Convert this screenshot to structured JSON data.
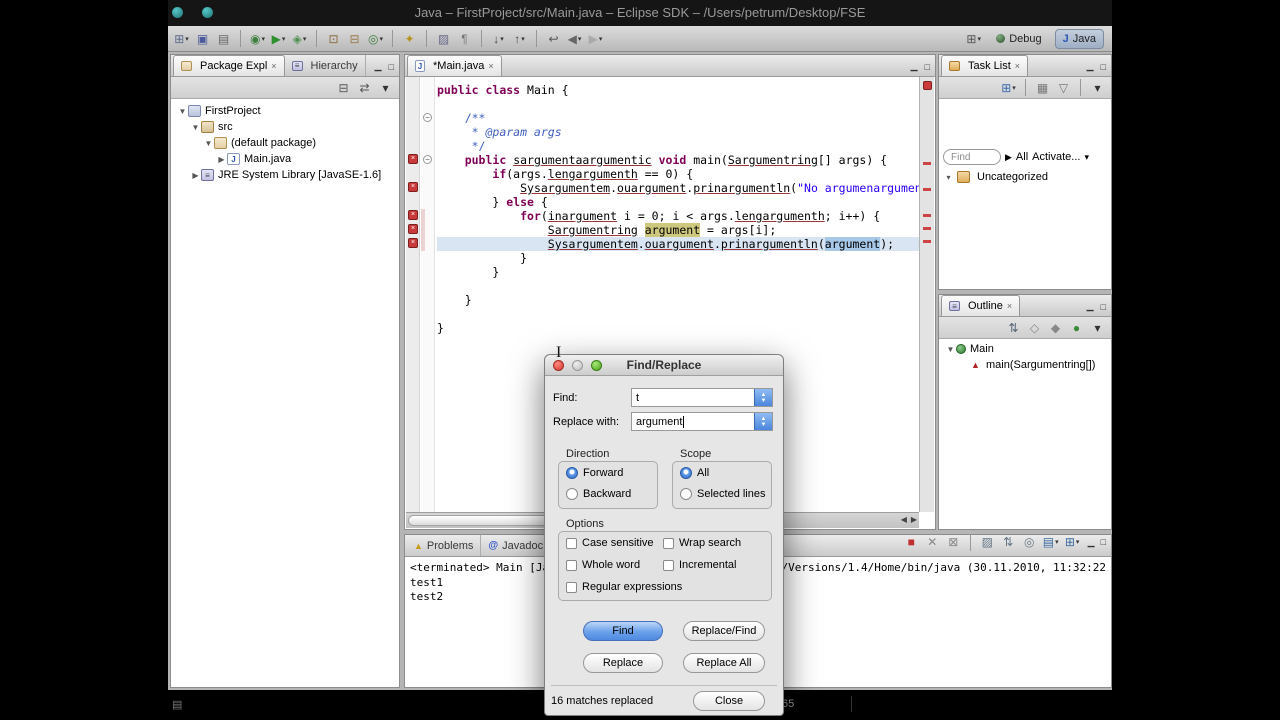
{
  "titlebar": {
    "title": "Java – FirstProject/src/Main.java – Eclipse SDK – /Users/petrum/Desktop/FSE"
  },
  "icons": {
    "minimize": "▁",
    "maximize": "□",
    "close": "×",
    "menu": "▾",
    "collapse_all": "⊟",
    "link_editor": "⇄",
    "chevron_right": "▶",
    "combo_up": "▲",
    "combo_down": "▼",
    "java_file": "J",
    "ibeam": "I",
    "warning": "▲",
    "at": "@",
    "pencil": "▤",
    "scroll_left": "◀",
    "scroll_right": "▶"
  },
  "toolbar": {
    "icons": [
      {
        "name": "new-wizard-icon",
        "glyph": "⊞",
        "color": "#5a6a8a",
        "dropdown": true
      },
      {
        "name": "save-icon",
        "glyph": "▣",
        "color": "#4a5a9a",
        "dropdown": false
      },
      {
        "name": "print-icon",
        "glyph": "▤",
        "color": "#666666",
        "dropdown": false
      },
      {
        "name": "sep"
      },
      {
        "name": "debug-icon",
        "glyph": "◉",
        "color": "#3f7f3f",
        "dropdown": true
      },
      {
        "name": "run-icon",
        "glyph": "▶",
        "color": "#2f8f2f",
        "dropdown": true
      },
      {
        "name": "external-tools-icon",
        "glyph": "◈",
        "color": "#4f8f4f",
        "dropdown": true
      },
      {
        "name": "sep"
      },
      {
        "name": "new-java-project-icon",
        "glyph": "⊡",
        "color": "#8a6a3a",
        "dropdown": false
      },
      {
        "name": "new-package-icon",
        "glyph": "⊟",
        "color": "#9a7a4a",
        "dropdown": false
      },
      {
        "name": "new-class-icon",
        "glyph": "◎",
        "color": "#3f7f3f",
        "dropdown": true
      },
      {
        "name": "sep"
      },
      {
        "name": "search-icon",
        "glyph": "✦",
        "color": "#b8941e",
        "dropdown": false
      },
      {
        "name": "sep"
      },
      {
        "name": "mark-occurrences-icon",
        "glyph": "▨",
        "color": "#6a6a8a",
        "dropdown": false
      },
      {
        "name": "show-whitespace-icon",
        "glyph": "¶",
        "color": "#777777",
        "dropdown": false
      },
      {
        "name": "sep"
      },
      {
        "name": "next-annotation-icon",
        "glyph": "↓",
        "color": "#444444",
        "dropdown": true
      },
      {
        "name": "prev-annotation-icon",
        "glyph": "↑",
        "color": "#444444",
        "dropdown": true
      },
      {
        "name": "sep"
      },
      {
        "name": "last-edit-icon",
        "glyph": "↩",
        "color": "#555555",
        "dropdown": false
      },
      {
        "name": "back-icon",
        "glyph": "◀",
        "color": "#666666",
        "dropdown": true
      },
      {
        "name": "forward-icon",
        "glyph": "▶",
        "color": "#aaaaaa",
        "dropdown": true
      }
    ],
    "open_perspective_glyph": "⊞",
    "perspectives": [
      {
        "label": "Debug",
        "active": false
      },
      {
        "label": "Java",
        "active": true
      }
    ]
  },
  "package_explorer": {
    "tabs": [
      {
        "label": "Package Expl"
      },
      {
        "label": "Hierarchy"
      }
    ],
    "toolbar": [
      {
        "name": "collapse-all-icon",
        "glyph": "⊟",
        "color": "#555555"
      },
      {
        "name": "link-with-editor-icon",
        "glyph": "⇄",
        "color": "#555555"
      },
      {
        "name": "view-menu-icon",
        "glyph": "▾",
        "color": "#333333"
      }
    ],
    "tree": [
      {
        "label": "FirstProject",
        "icon": "project",
        "indent": 0,
        "expander": "open"
      },
      {
        "label": "src",
        "icon": "src",
        "indent": 1,
        "expander": "open"
      },
      {
        "label": "(default package)",
        "icon": "package",
        "indent": 2,
        "expander": "open"
      },
      {
        "label": "Main.java",
        "icon": "jfile",
        "indent": 3,
        "expander": "closed"
      },
      {
        "label": "JRE System Library [JavaSE-1.6]",
        "icon": "library",
        "indent": 1,
        "expander": "closed"
      }
    ]
  },
  "editor": {
    "tab_label": "*Main.java",
    "code": [
      {
        "segs": [
          [
            "public",
            "k"
          ],
          [
            " ",
            "p"
          ],
          [
            "class",
            "k"
          ],
          [
            " Main {",
            "p"
          ]
        ]
      },
      {
        "segs": []
      },
      {
        "segs": [
          [
            "    /**",
            "c"
          ]
        ]
      },
      {
        "segs": [
          [
            "     * ",
            "c"
          ],
          [
            "@param args",
            "ci"
          ]
        ]
      },
      {
        "segs": [
          [
            "     */",
            "c"
          ]
        ]
      },
      {
        "segs": [
          [
            "    ",
            "p"
          ],
          [
            "public",
            "k"
          ],
          [
            " ",
            "p"
          ],
          [
            "sargumentaargumentic",
            "e"
          ],
          [
            " ",
            "p"
          ],
          [
            "void",
            "k"
          ],
          [
            " main(",
            "p"
          ],
          [
            "Sargumentring",
            "e"
          ],
          [
            "[] args) {",
            "p"
          ]
        ]
      },
      {
        "segs": [
          [
            "        ",
            "p"
          ],
          [
            "if",
            "k"
          ],
          [
            "(args.",
            "p"
          ],
          [
            "lengargumenth",
            "e"
          ],
          [
            " == 0) {",
            "p"
          ]
        ]
      },
      {
        "segs": [
          [
            "            ",
            "p"
          ],
          [
            "Sysargumentem",
            "e"
          ],
          [
            ".",
            "p"
          ],
          [
            "ouargument",
            "e"
          ],
          [
            ".",
            "p"
          ],
          [
            "prinargumentln",
            "e"
          ],
          [
            "(",
            "p"
          ],
          [
            "\"No argumenarguments",
            "s"
          ]
        ]
      },
      {
        "segs": [
          [
            "        } ",
            "p"
          ],
          [
            "else",
            "k"
          ],
          [
            " {",
            "p"
          ]
        ]
      },
      {
        "segs": [
          [
            "            ",
            "p"
          ],
          [
            "for",
            "k"
          ],
          [
            "(",
            "p"
          ],
          [
            "inargument",
            "e"
          ],
          [
            " i = 0; i < args.",
            "p"
          ],
          [
            "lengargumenth",
            "e"
          ],
          [
            "; i++) {",
            "p"
          ]
        ]
      },
      {
        "segs": [
          [
            "                ",
            "p"
          ],
          [
            "Sargumentring",
            "e"
          ],
          [
            " ",
            "p"
          ],
          [
            "argument",
            "hl"
          ],
          [
            " = args[i];",
            "p"
          ]
        ]
      },
      {
        "sel": true,
        "segs": [
          [
            "                ",
            "p"
          ],
          [
            "Sysargumentem",
            "e"
          ],
          [
            ".",
            "p"
          ],
          [
            "ouargument",
            "e"
          ],
          [
            ".",
            "p"
          ],
          [
            "prinargumentln",
            "e"
          ],
          [
            "(",
            "p"
          ],
          [
            "argument",
            "sel"
          ],
          [
            ");",
            "p"
          ]
        ]
      },
      {
        "segs": [
          [
            "            }",
            "p"
          ]
        ]
      },
      {
        "segs": [
          [
            "        }",
            "p"
          ]
        ]
      },
      {
        "segs": []
      },
      {
        "segs": [
          [
            "    }",
            "p"
          ]
        ]
      },
      {
        "segs": []
      },
      {
        "segs": [
          [
            "}",
            "p"
          ]
        ]
      }
    ],
    "error_lines": [
      5,
      7,
      9,
      10,
      11
    ],
    "fold_lines": [
      2,
      5
    ],
    "range_band": {
      "from": 9,
      "to": 11
    }
  },
  "task_list": {
    "tab": "Task List",
    "toolbar": [
      {
        "name": "new-task-icon",
        "glyph": "⊞",
        "color": "#3a6ab0",
        "dropdown": true
      },
      {
        "name": "sep"
      },
      {
        "name": "categorize-icon",
        "glyph": "▦",
        "color": "#777777"
      },
      {
        "name": "filter-icon",
        "glyph": "▽",
        "color": "#777777"
      },
      {
        "name": "sep"
      },
      {
        "name": "view-menu-icon",
        "glyph": "▾",
        "color": "#333333"
      }
    ],
    "find_placeholder": "Find",
    "filter_all": "All",
    "activate": "Activate...",
    "category": "Uncategorized"
  },
  "outline": {
    "tab": "Outline",
    "toolbar": [
      {
        "name": "sort-icon",
        "glyph": "⇅",
        "color": "#556677"
      },
      {
        "name": "hide-fields-icon",
        "glyph": "◇",
        "color": "#888888"
      },
      {
        "name": "hide-static-icon",
        "glyph": "◆",
        "color": "#888888"
      },
      {
        "name": "hide-nonpublic-icon",
        "glyph": "●",
        "color": "#3a8a3a"
      },
      {
        "name": "view-menu-icon",
        "glyph": "▾",
        "color": "#333333"
      }
    ],
    "tree": [
      {
        "label": "Main",
        "icon": "class",
        "indent": 0,
        "expander": "open"
      },
      {
        "label": "main(Sargumentring[])",
        "icon": "method-error",
        "indent": 1,
        "expander": null
      }
    ]
  },
  "bottom_panel": {
    "tabs": [
      {
        "label": "Problems"
      },
      {
        "label": "Javadoc"
      }
    ],
    "toolbar": [
      {
        "name": "terminate-icon",
        "glyph": "■",
        "color": "#c03030"
      },
      {
        "name": "remove-launch-icon",
        "glyph": "✕",
        "color": "#888888"
      },
      {
        "name": "remove-all-launches-icon",
        "glyph": "⊠",
        "color": "#888888"
      },
      {
        "name": "sep"
      },
      {
        "name": "clear-console-icon",
        "glyph": "▨",
        "color": "#667788"
      },
      {
        "name": "scroll-lock-icon",
        "glyph": "⇅",
        "color": "#667788"
      },
      {
        "name": "pin-console-icon",
        "glyph": "◎",
        "color": "#667788"
      },
      {
        "name": "console-select-icon",
        "glyph": "▤",
        "color": "#3a6aa0",
        "dropdown": true
      },
      {
        "name": "open-console-icon",
        "glyph": "⊞",
        "color": "#3a6aa0",
        "dropdown": true
      }
    ],
    "header_left": "<terminated> Main [Java A",
    "header_right": "M.framework/Versions/1.4/Home/bin/java (30.11.2010, 11:32:22",
    "lines": [
      "test1",
      "test2"
    ]
  },
  "status_bar": {
    "cursor_position": "65"
  },
  "dialog": {
    "title": "Find/Replace",
    "find_label": "Find:",
    "find_value": "t",
    "replace_label": "Replace with:",
    "replace_value": "argument",
    "direction": {
      "legend": "Direction",
      "options": [
        {
          "label": "Forward",
          "selected": true
        },
        {
          "label": "Backward",
          "selected": false
        }
      ]
    },
    "scope": {
      "legend": "Scope",
      "options": [
        {
          "label": "All",
          "selected": true
        },
        {
          "label": "Selected lines",
          "selected": false
        }
      ]
    },
    "options": {
      "legend": "Options",
      "checkboxes": [
        {
          "label": "Case sensitive",
          "checked": false
        },
        {
          "label": "Wrap search",
          "checked": false
        },
        {
          "label": "Whole word",
          "checked": false
        },
        {
          "label": "Incremental",
          "checked": false
        },
        {
          "label": "Regular expressions",
          "checked": false
        }
      ]
    },
    "buttons": {
      "find": "Find",
      "replace_find": "Replace/Find",
      "replace": "Replace",
      "replace_all": "Replace All",
      "close": "Close"
    },
    "status": "16 matches replaced"
  }
}
